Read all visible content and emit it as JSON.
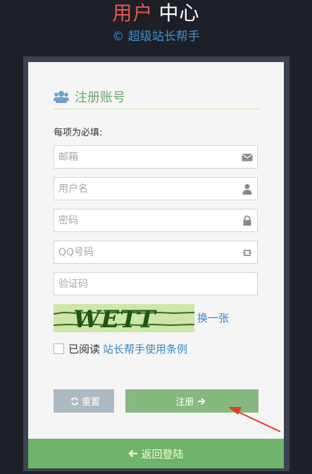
{
  "header": {
    "title_part1": "用户",
    "title_part2": "中心",
    "subtitle": "© 超级站长帮手"
  },
  "form": {
    "title": "注册账号",
    "required_note": "每项为必填:",
    "fields": [
      {
        "placeholder": "邮箱",
        "icon": "envelope-icon"
      },
      {
        "placeholder": "用户名",
        "icon": "user-icon"
      },
      {
        "placeholder": "密码",
        "icon": "lock-icon"
      },
      {
        "placeholder": "QQ号码",
        "icon": "retweet-icon"
      },
      {
        "placeholder": "验证码",
        "icon": ""
      }
    ],
    "captcha_text": "WETT",
    "captcha_refresh": "换一张",
    "agree_prefix": "已阅读",
    "agree_link": "站长帮手使用条例",
    "reset_label": "重置",
    "register_label": "注册",
    "back_label": "返回登陆"
  },
  "colors": {
    "background": "#1d2027",
    "frame": "#3b4352",
    "card": "#f5f5f5",
    "title_red": "#e2574c",
    "link_blue": "#3a87c8",
    "green": "#87b87f",
    "reset_gray": "#abbac3",
    "arrow_red": "#e53935"
  }
}
